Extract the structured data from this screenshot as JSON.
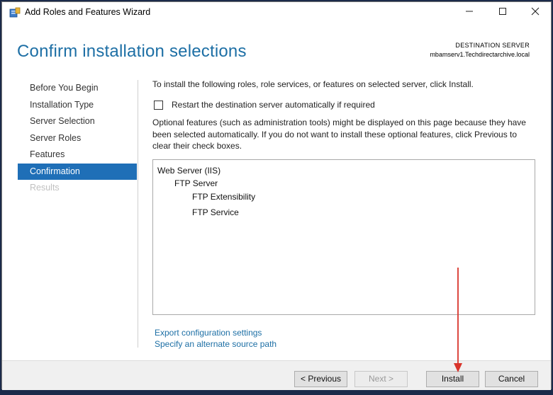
{
  "window": {
    "title": "Add Roles and Features Wizard"
  },
  "header": {
    "title": "Confirm installation selections",
    "destination_label": "DESTINATION SERVER",
    "destination_server": "mbamserv1.Techdirectarchive.local"
  },
  "nav": {
    "items": [
      {
        "label": "Before You Begin"
      },
      {
        "label": "Installation Type"
      },
      {
        "label": "Server Selection"
      },
      {
        "label": "Server Roles"
      },
      {
        "label": "Features"
      },
      {
        "label": "Confirmation"
      },
      {
        "label": "Results"
      }
    ]
  },
  "content": {
    "intro": "To install the following roles, role services, or features on selected server, click Install.",
    "restart_label": "Restart the destination server automatically if required",
    "optional_text": "Optional features (such as administration tools) might be displayed on this page because they have been selected automatically. If you do not want to install these optional features, click Previous to clear their check boxes.",
    "selections": [
      {
        "label": "Web Server (IIS)"
      },
      {
        "label": "FTP Server"
      },
      {
        "label": "FTP Extensibility"
      },
      {
        "label": "FTP Service"
      }
    ],
    "export_link": "Export configuration settings",
    "source_link": "Specify an alternate source path"
  },
  "footer": {
    "previous_label": "< Previous",
    "next_label": "Next >",
    "install_label": "Install",
    "cancel_label": "Cancel"
  },
  "colors": {
    "accent": "#1f6fb7",
    "title_blue": "#1d6fa5",
    "annotation_arrow": "#d9342b"
  },
  "icons": {
    "app": "server-manager-icon",
    "minimize": "minimize-icon",
    "maximize": "maximize-icon",
    "close": "close-icon"
  }
}
